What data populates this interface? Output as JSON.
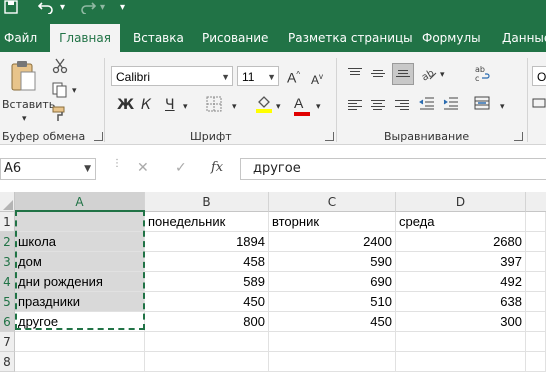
{
  "colors": {
    "accent": "#217346",
    "selection": "#d9d9d9"
  },
  "quick_access": {
    "save_icon": "save-icon",
    "undo_icon": "undo-icon",
    "redo_icon": "redo-icon"
  },
  "tabs": [
    "Файл",
    "Главная",
    "Вставка",
    "Рисование",
    "Разметка страницы",
    "Формулы",
    "Данные"
  ],
  "ribbon": {
    "clipboard": {
      "paste_label": "Вставить",
      "group_label": "Буфер обмена"
    },
    "font": {
      "name": "Calibri",
      "size": "11",
      "grow": "A",
      "shrink": "A",
      "bold": "Ж",
      "italic": "К",
      "underline": "Ч",
      "font_color": "A",
      "group_label": "Шрифт"
    },
    "alignment": {
      "group_label": "Выравнивание"
    },
    "number": {
      "format_label": "О"
    }
  },
  "formula_bar": {
    "name_box": "A6",
    "cancel": "✕",
    "enter": "✓",
    "fx": "fx",
    "value": "другое"
  },
  "sheet": {
    "columns": [
      "A",
      "B",
      "C",
      "D"
    ],
    "rows": [
      "1",
      "2",
      "3",
      "4",
      "5",
      "6",
      "7",
      "8"
    ],
    "headers": [
      "",
      "понедельник",
      "вторник",
      "среда"
    ],
    "data": [
      [
        "школа",
        "1894",
        "2400",
        "2680"
      ],
      [
        "дом",
        "458",
        "590",
        "397"
      ],
      [
        "дни рождения",
        "589",
        "690",
        "492"
      ],
      [
        "праздники",
        "450",
        "510",
        "638"
      ],
      [
        "другое",
        "800",
        "450",
        "300"
      ]
    ]
  }
}
